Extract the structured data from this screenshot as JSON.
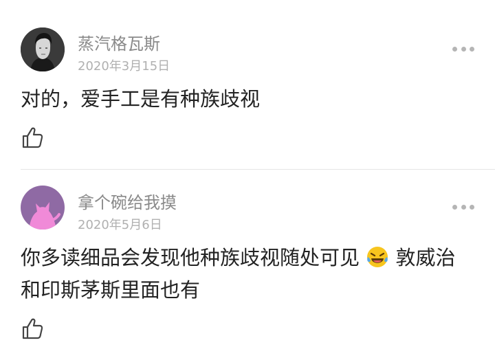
{
  "comments": [
    {
      "username": "蒸汽格瓦斯",
      "date": "2020年3月15日",
      "text": "对的，爱手工是有种族歧视",
      "avatar": "portrait-avatar"
    },
    {
      "username": "拿个碗给我摸",
      "date": "2020年5月6日",
      "text_before_emoji": "你多读细品会发现他种族歧视随处可见",
      "emoji": "laughing-tears-emoji",
      "text_after_emoji": "敦威治和印斯茅斯里面也有",
      "avatar": "pink-cat-avatar"
    }
  ],
  "icons": {
    "like": "thumbs-up-icon",
    "more": "more-dots-icon"
  },
  "colors": {
    "username": "#8a8a8a",
    "date": "#b0b0b0",
    "text": "#222222",
    "divider": "#e6e6e6",
    "cat_avatar_bg": "#8f6aa4",
    "cat_color": "#f08ad8"
  }
}
